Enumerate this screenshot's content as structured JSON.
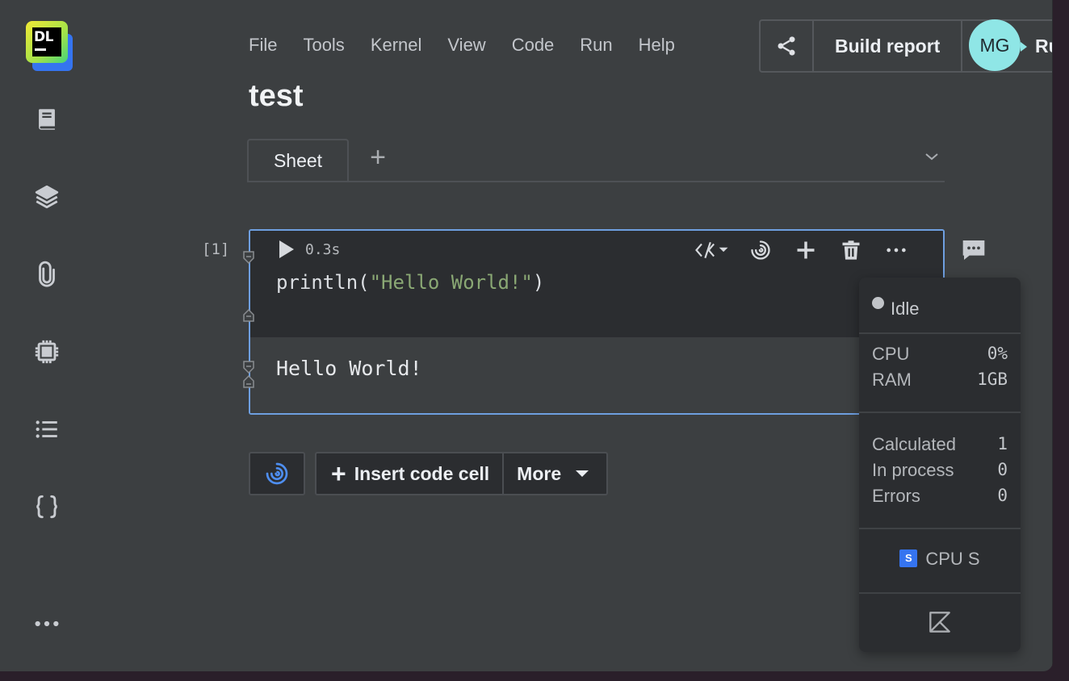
{
  "logo": {
    "text": "DL"
  },
  "menu": {
    "items": [
      "File",
      "Tools",
      "Kernel",
      "View",
      "Code",
      "Run",
      "Help"
    ]
  },
  "toolbar": {
    "build_report": "Build report",
    "avatar_initials": "MG",
    "run_partial": "Ru"
  },
  "notebook": {
    "title": "test"
  },
  "tabs": {
    "active": "Sheet",
    "add": "+"
  },
  "cell": {
    "index": "[1]",
    "exec_time": "0.3s",
    "code_fn": "println(",
    "code_str": "\"Hello World!\"",
    "code_end": ")",
    "output": "Hello World!"
  },
  "actions": {
    "insert_label": "Insert code cell",
    "insert_plus": "+",
    "more_label": "More"
  },
  "status": {
    "state": "Idle",
    "cpu_label": "CPU",
    "cpu_value": "0%",
    "ram_label": "RAM",
    "ram_value": "1GB",
    "calculated_label": "Calculated",
    "calculated_value": "1",
    "inprocess_label": "In process",
    "inprocess_value": "0",
    "errors_label": "Errors",
    "errors_value": "0",
    "machine_badge": "S",
    "machine_label": "CPU S"
  },
  "colors": {
    "accent": "#3574f0",
    "cell_border": "#6e9fe0",
    "avatar": "#8fe6e6",
    "string": "#8aa874"
  },
  "icons": {
    "sidebar": [
      "book-icon",
      "layers-icon",
      "paperclip-icon",
      "chip-icon",
      "list-icon",
      "braces-icon",
      "more-dots-icon"
    ],
    "cell_tools": [
      "code-view-icon",
      "ai-spiral-icon",
      "add-icon",
      "trash-icon",
      "more-icon"
    ]
  }
}
